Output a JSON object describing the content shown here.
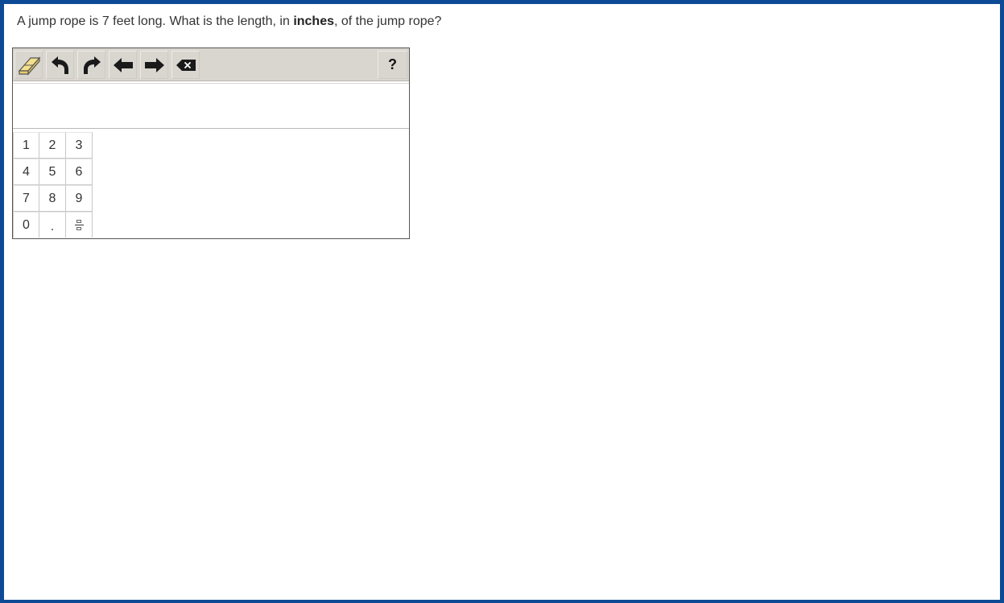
{
  "question": {
    "prefix": "A jump rope is 7 feet long. What is the length, in ",
    "bold": "inches",
    "suffix": ", of the jump rope?"
  },
  "toolbar": {
    "buttons": [
      "eraser-icon",
      "undo-icon",
      "redo-icon",
      "arrow-left-icon",
      "arrow-right-icon",
      "backspace-icon"
    ],
    "help_label": "?"
  },
  "answer": {
    "value": ""
  },
  "keypad": {
    "keys": [
      "1",
      "2",
      "3",
      "4",
      "5",
      "6",
      "7",
      "8",
      "9",
      "0",
      "."
    ],
    "fraction_key": "fraction-icon"
  },
  "colors": {
    "frame_border": "#0d4a96",
    "toolbar_bg": "#d9d6d0",
    "eraser": "#f3e08c"
  }
}
